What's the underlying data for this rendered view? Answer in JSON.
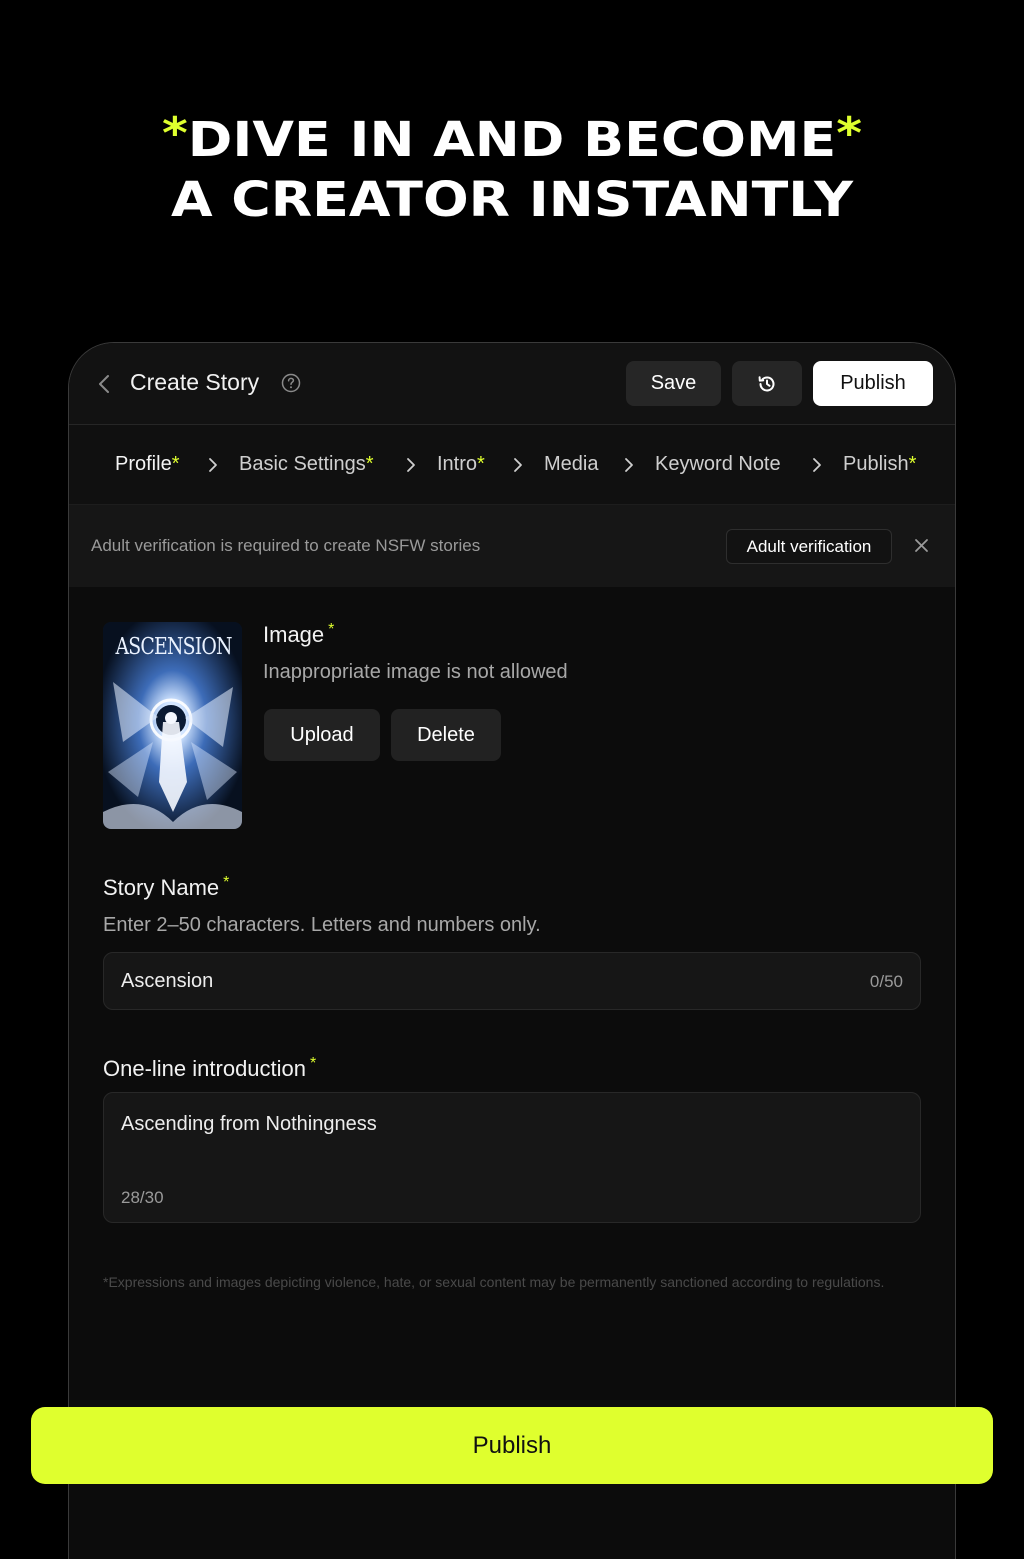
{
  "headline": {
    "line1": "DIVE IN AND BECOME",
    "line2": "A CREATOR INSTANTLY",
    "star": "*"
  },
  "topbar": {
    "title": "Create Story",
    "save_label": "Save",
    "publish_label": "Publish"
  },
  "steps": [
    {
      "label": "Profile",
      "req": "*"
    },
    {
      "label": "Basic Settings",
      "req": "*"
    },
    {
      "label": "Intro",
      "req": "*"
    },
    {
      "label": "Media",
      "req": ""
    },
    {
      "label": "Keyword Note",
      "req": ""
    },
    {
      "label": "Publish",
      "req": "*"
    }
  ],
  "notice": {
    "text": "Adult verification is required to create NSFW stories",
    "button": "Adult verification"
  },
  "image_section": {
    "cover_title": "ASCENSION",
    "label": "Image",
    "req": "*",
    "hint": "Inappropriate image is not allowed",
    "upload_label": "Upload",
    "delete_label": "Delete"
  },
  "story_name": {
    "label": "Story Name",
    "req": "*",
    "hint": "Enter 2–50 characters. Letters and numbers only.",
    "value": "Ascension",
    "count": "0/50"
  },
  "intro": {
    "label": "One-line introduction",
    "req": "*",
    "value": "Ascending from Nothingness",
    "count": "28/30"
  },
  "disclaimer": "*Expressions and images depicting violence, hate, or sexual content may be permanently sanctioned according to regulations.",
  "cta_label": "Publish",
  "colors": {
    "accent": "#dfff2e",
    "background": "#000000",
    "panel": "#0c0c0c"
  }
}
